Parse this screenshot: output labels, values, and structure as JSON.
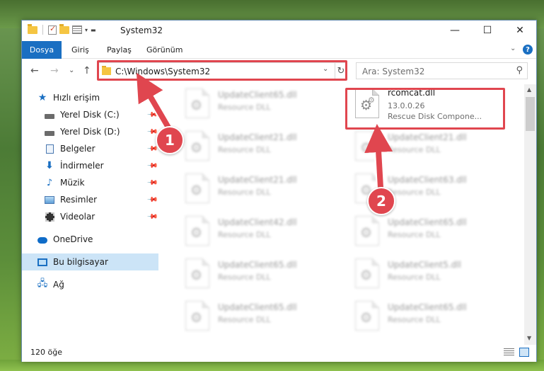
{
  "window": {
    "title": "System32",
    "controls": {
      "minimize": "—",
      "maximize": "☐",
      "close": "✕"
    }
  },
  "ribbon": {
    "file_tab": "Dosya",
    "tabs": [
      "Giriş",
      "Paylaş",
      "Görünüm"
    ],
    "help": "?"
  },
  "address": {
    "path": "C:\\Windows\\System32",
    "search_placeholder": "Ara: System32"
  },
  "nav_pane": {
    "items": [
      {
        "label": "Hızlı erişim",
        "icon": "star-icon"
      },
      {
        "label": "Yerel Disk (C:)",
        "icon": "drive-icon",
        "pinned": true
      },
      {
        "label": "Yerel Disk (D:)",
        "icon": "drive-icon",
        "pinned": true
      },
      {
        "label": "Belgeler",
        "icon": "documents-icon",
        "pinned": true
      },
      {
        "label": "İndirmeler",
        "icon": "download-icon",
        "pinned": true
      },
      {
        "label": "Müzik",
        "icon": "music-icon",
        "pinned": true
      },
      {
        "label": "Resimler",
        "icon": "pictures-icon",
        "pinned": true
      },
      {
        "label": "Videolar",
        "icon": "videos-icon",
        "pinned": true
      },
      {
        "label": "OneDrive",
        "icon": "cloud-icon"
      },
      {
        "label": "Bu bilgisayar",
        "icon": "computer-icon",
        "selected": true
      },
      {
        "label": "Ağ",
        "icon": "network-icon"
      }
    ]
  },
  "files": {
    "target": {
      "name": "rcomcat.dll",
      "version": "13.0.0.26",
      "type": "Rescue Disk Compone..."
    },
    "left_column": [
      {
        "name": "UpdateClient65.dll",
        "type": "Resource DLL"
      },
      {
        "name": "UpdateClient21.dll",
        "type": "Resource DLL"
      },
      {
        "name": "UpdateClient21.dll",
        "type": "Resource DLL"
      },
      {
        "name": "UpdateClient42.dll",
        "type": "Resource DLL"
      },
      {
        "name": "UpdateClient65.dll",
        "type": "Resource DLL"
      },
      {
        "name": "UpdateClient65.dll",
        "type": "Resource DLL"
      }
    ],
    "right_column": [
      {
        "name": "UpdateClient21.dll",
        "type": "Resource DLL"
      },
      {
        "name": "UpdateClient63.dll",
        "type": "Resource DLL"
      },
      {
        "name": "UpdateClient65.dll",
        "type": "Resource DLL"
      },
      {
        "name": "UpdateClient5.dll",
        "type": "Resource DLL"
      },
      {
        "name": "UpdateClient65.dll",
        "type": "Resource DLL"
      }
    ]
  },
  "status": {
    "item_count": "120 öğe"
  },
  "callouts": {
    "first": "1",
    "second": "2"
  },
  "colors": {
    "accent": "#1a6fc2",
    "highlight": "#e0464f",
    "selection": "#cce4f7"
  }
}
